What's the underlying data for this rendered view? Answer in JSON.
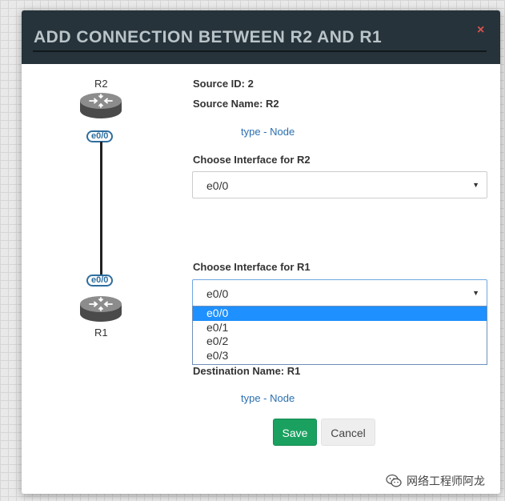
{
  "modal": {
    "title": "ADD CONNECTION BETWEEN R2 AND R1",
    "close_glyph": "×"
  },
  "diagram": {
    "source_node": {
      "label": "R2",
      "interface": "e0/0",
      "icon": "router-icon"
    },
    "dest_node": {
      "label": "R1",
      "interface": "e0/0",
      "icon": "router-icon"
    },
    "link_color": "#222222"
  },
  "form": {
    "source_id": "Source ID: 2",
    "source_name": "Source Name: R2",
    "source_type_link": "type - Node",
    "source_interface_label": "Choose Interface for R2",
    "source_interface_value": "e0/0",
    "dest_interface_label": "Choose Interface for R1",
    "dest_interface_value": "e0/0",
    "dest_interface_options": [
      "e0/0",
      "e0/1",
      "e0/2",
      "e0/3"
    ],
    "dest_interface_selected_index": 0,
    "destination_name": "Destination Name: R1",
    "dest_type_link": "type - Node",
    "select_arrow": "▼"
  },
  "buttons": {
    "save": "Save",
    "cancel": "Cancel"
  },
  "watermark": {
    "text": "网络工程师阿龙",
    "icon": "wechat-icon"
  },
  "colors": {
    "header_bg": "#26333a",
    "title_text": "#b9c4c9",
    "close": "#d9534f",
    "save_bg": "#1aa160",
    "link": "#2a6fb0",
    "dropdown_highlight": "#1e90ff"
  }
}
